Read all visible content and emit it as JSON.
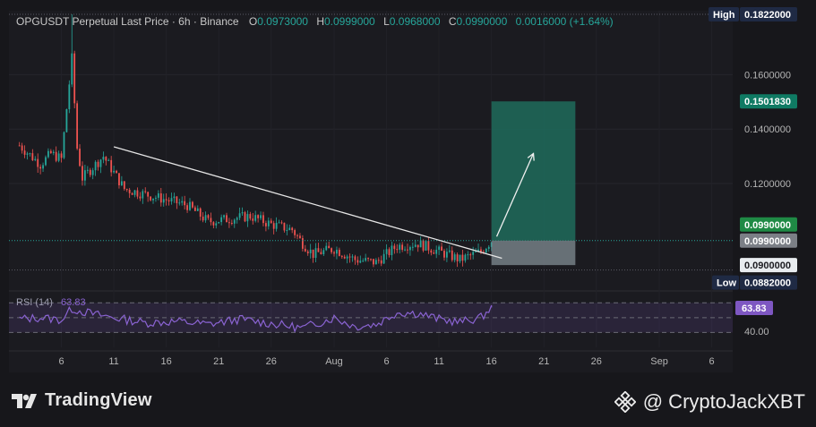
{
  "header": {
    "symbol_text": "OPGUSDT Perpetual Last Price · 6h · Binance",
    "o_label": "O",
    "o_value": "0.0973000",
    "h_label": "H",
    "h_value": "0.0999000",
    "l_label": "L",
    "l_value": "0.0968000",
    "c_label": "C",
    "c_value": "0.0990000",
    "change": "0.0016000 (+1.64%)"
  },
  "colors": {
    "background": "#1b1b20",
    "up": "#26a69a",
    "down": "#ef5350",
    "rsi_line": "#7e57c2",
    "target_zone": "#1e6b5c",
    "stop_zone": "#6e7a80",
    "trendline": "#e6e6e6"
  },
  "price_badges": {
    "high_label": "High",
    "high_value": "0.1822000",
    "target_value": "0.1501830",
    "entry_value": "0.0990000",
    "last_value": "0.0990000",
    "stop_value": "0.0900000",
    "low_label": "Low",
    "low_value": "0.0882000"
  },
  "rsi": {
    "label": "RSI (14)",
    "value": "63.83",
    "level_label": "40.00"
  },
  "watermark": {
    "brand": "TradingView",
    "author": "@ CryptoJackXBT"
  },
  "chart_data": {
    "type": "candlestick",
    "title": "OPGUSDT Perpetual Last Price · 6h · Binance",
    "y_ticks": [
      0.14,
      0.12,
      0.16
    ],
    "y_tick_labels": [
      "0.1400000",
      "0.1200000",
      "0.1600000"
    ],
    "ylim": [
      0.0805,
      0.1835
    ],
    "x_tick_labels": [
      "6",
      "11",
      "16",
      "21",
      "26",
      "Aug",
      "6",
      "11",
      "16",
      "21",
      "26",
      "Sep",
      "6"
    ],
    "x_tick_dates": [
      "2025-07-06",
      "2025-07-11",
      "2025-07-16",
      "2025-07-21",
      "2025-07-26",
      "2025-08-01",
      "2025-08-06",
      "2025-08-11",
      "2025-08-16",
      "2025-08-21",
      "2025-08-26",
      "2025-09-01",
      "2025-09-06"
    ],
    "key_levels": {
      "high": 0.1822,
      "low": 0.0882,
      "target": 0.150183,
      "entry": 0.099,
      "stop": 0.09
    },
    "price_path": [
      [
        "2025-07-02",
        0.134
      ],
      [
        "2025-07-04",
        0.127
      ],
      [
        "2025-07-05",
        0.131
      ],
      [
        "2025-07-06",
        0.129
      ],
      [
        "2025-07-07",
        0.166
      ],
      [
        "2025-07-07T12",
        0.133
      ],
      [
        "2025-07-08",
        0.122
      ],
      [
        "2025-07-09",
        0.126
      ],
      [
        "2025-07-10",
        0.13
      ],
      [
        "2025-07-11",
        0.124
      ],
      [
        "2025-07-12",
        0.118
      ],
      [
        "2025-07-14",
        0.116
      ],
      [
        "2025-07-16",
        0.114
      ],
      [
        "2025-07-17",
        0.113
      ],
      [
        "2025-07-18",
        0.112
      ],
      [
        "2025-07-20",
        0.106
      ],
      [
        "2025-07-22",
        0.107
      ],
      [
        "2025-07-24",
        0.108
      ],
      [
        "2025-07-26",
        0.105
      ],
      [
        "2025-07-28",
        0.103
      ],
      [
        "2025-07-29",
        0.098
      ],
      [
        "2025-07-30",
        0.094
      ],
      [
        "2025-08-01",
        0.096
      ],
      [
        "2025-08-03",
        0.092
      ],
      [
        "2025-08-05",
        0.091
      ],
      [
        "2025-08-07",
        0.097
      ],
      [
        "2025-08-09",
        0.098
      ],
      [
        "2025-08-11",
        0.095
      ],
      [
        "2025-08-13",
        0.092
      ],
      [
        "2025-08-15",
        0.095
      ],
      [
        "2025-08-16",
        0.099
      ]
    ],
    "trendline": [
      [
        "2025-07-11",
        0.1335
      ],
      [
        "2025-08-17",
        0.0925
      ]
    ],
    "rsi_series": [
      [
        "2025-07-02",
        48
      ],
      [
        "2025-07-04",
        50
      ],
      [
        "2025-07-06",
        47
      ],
      [
        "2025-07-07",
        62
      ],
      [
        "2025-07-09",
        55
      ],
      [
        "2025-07-11",
        50
      ],
      [
        "2025-07-14",
        43
      ],
      [
        "2025-07-17",
        45
      ],
      [
        "2025-07-20",
        41
      ],
      [
        "2025-07-23",
        48
      ],
      [
        "2025-07-26",
        42
      ],
      [
        "2025-07-29",
        36
      ],
      [
        "2025-08-01",
        50
      ],
      [
        "2025-08-03",
        38
      ],
      [
        "2025-08-05",
        41
      ],
      [
        "2025-08-07",
        57
      ],
      [
        "2025-08-09",
        56
      ],
      [
        "2025-08-11",
        48
      ],
      [
        "2025-08-13",
        44
      ],
      [
        "2025-08-15",
        50
      ],
      [
        "2025-08-16",
        63.83
      ]
    ],
    "rsi_levels": [
      70,
      50,
      30
    ]
  }
}
